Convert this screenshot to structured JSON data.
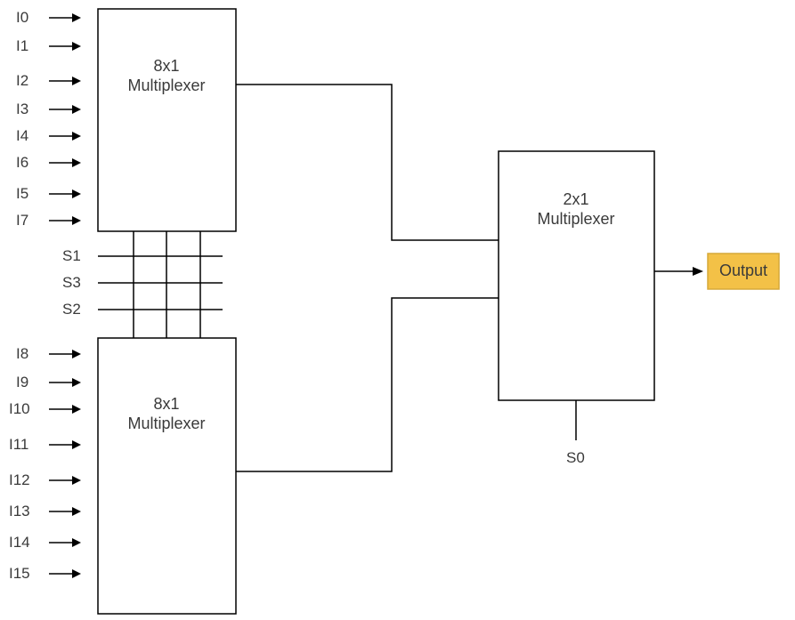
{
  "inputs_top": [
    "I0",
    "I1",
    "I2",
    "I3",
    "I4",
    "I6",
    "I5",
    "I7"
  ],
  "inputs_bottom": [
    "I8",
    "I9",
    "I10",
    "I11",
    "I12",
    "I13",
    "I14",
    "I15"
  ],
  "selects_mid": [
    "S1",
    "S3",
    "S2"
  ],
  "select_final": "S0",
  "mux8_label_l1": "8x1",
  "mux8_label_l2": "Multiplexer",
  "mux2_label_l1": "2x1",
  "mux2_label_l2": "Multiplexer",
  "output_label": "Output",
  "chart_data": {
    "type": "diagram",
    "title": "16-input multiplexer built from two 8x1 MUX and one 2x1 MUX",
    "components": [
      {
        "id": "mux8_top",
        "type": "8x1 Multiplexer",
        "inputs": [
          "I0",
          "I1",
          "I2",
          "I3",
          "I4",
          "I6",
          "I5",
          "I7"
        ],
        "selects": [
          "S1",
          "S3",
          "S2"
        ],
        "output": "m0"
      },
      {
        "id": "mux8_bottom",
        "type": "8x1 Multiplexer",
        "inputs": [
          "I8",
          "I9",
          "I10",
          "I11",
          "I12",
          "I13",
          "I14",
          "I15"
        ],
        "selects": [
          "S1",
          "S3",
          "S2"
        ],
        "output": "m1"
      },
      {
        "id": "mux2",
        "type": "2x1 Multiplexer",
        "inputs": [
          "m0",
          "m1"
        ],
        "selects": [
          "S0"
        ],
        "output": "Output"
      }
    ],
    "connections": [
      {
        "from": "mux8_top.output",
        "to": "mux2.input0"
      },
      {
        "from": "mux8_bottom.output",
        "to": "mux2.input1"
      },
      {
        "from": "mux2.output",
        "to": "Output"
      }
    ]
  }
}
